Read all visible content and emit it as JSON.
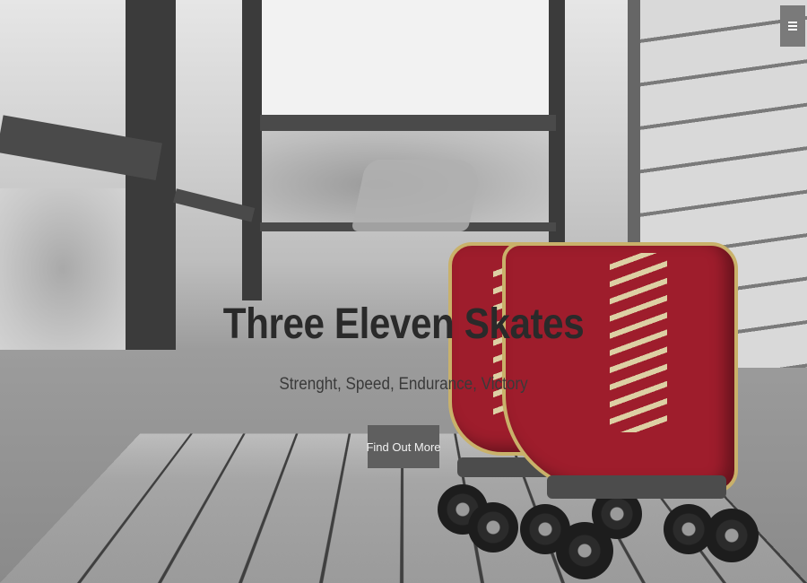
{
  "hero": {
    "title": "Three Eleven Skates",
    "tagline": "Strenght, Speed, Endurance, Victory",
    "cta_label": "Find Out More"
  },
  "nav": {
    "menu_icon": "hamburger-menu-icon"
  },
  "colors": {
    "skate_red": "#9e1d2c",
    "button_bg": "#5f5f5f",
    "title_text": "#2a2a2a"
  }
}
